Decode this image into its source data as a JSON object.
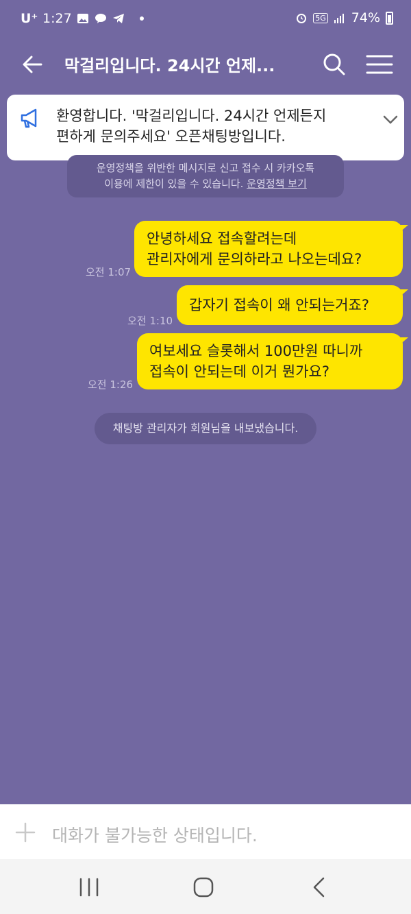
{
  "status_bar": {
    "carrier": "U⁺",
    "time": "1:27",
    "battery": "74%",
    "network": "5G"
  },
  "header": {
    "title": "막걸리입니다. 24시간 언제..."
  },
  "notice": {
    "line1": "환영합니다. '막걸리입니다. 24시간 언제든지",
    "line2": "편하게 문의주세요' 오픈채팅방입니다."
  },
  "policy": {
    "line1": "운영정책을 위반한 메시지로 신고 접수 시 카카오톡",
    "line2": "이용에 제한이 있을 수 있습니다. ",
    "link": "운영정책 보기"
  },
  "messages": [
    {
      "line1": "안녕하세요 접속할려는데",
      "line2": "관리자에게 문의하라고 나오는데요?",
      "time": "오전 1:07"
    },
    {
      "line1": "갑자기 접속이 왜 안되는거죠?",
      "time": "오전 1:10"
    },
    {
      "line1": "여보세요 슬롯해서 100만원 따니까",
      "line2": "접속이 안되는데 이거 뭔가요?",
      "time": "오전 1:26"
    }
  ],
  "system_message": "채팅방 관리자가 회원님을 내보냈습니다.",
  "input": {
    "placeholder": "대화가 불가능한 상태입니다."
  },
  "colors": {
    "background": "#7268a1",
    "bubble": "#fee500",
    "system_pill": "#635a8f"
  },
  "icons": [
    "back-arrow-icon",
    "search-icon",
    "menu-icon",
    "megaphone-icon",
    "chevron-down-icon",
    "plus-icon",
    "recent-apps-icon",
    "home-icon",
    "nav-back-icon"
  ]
}
